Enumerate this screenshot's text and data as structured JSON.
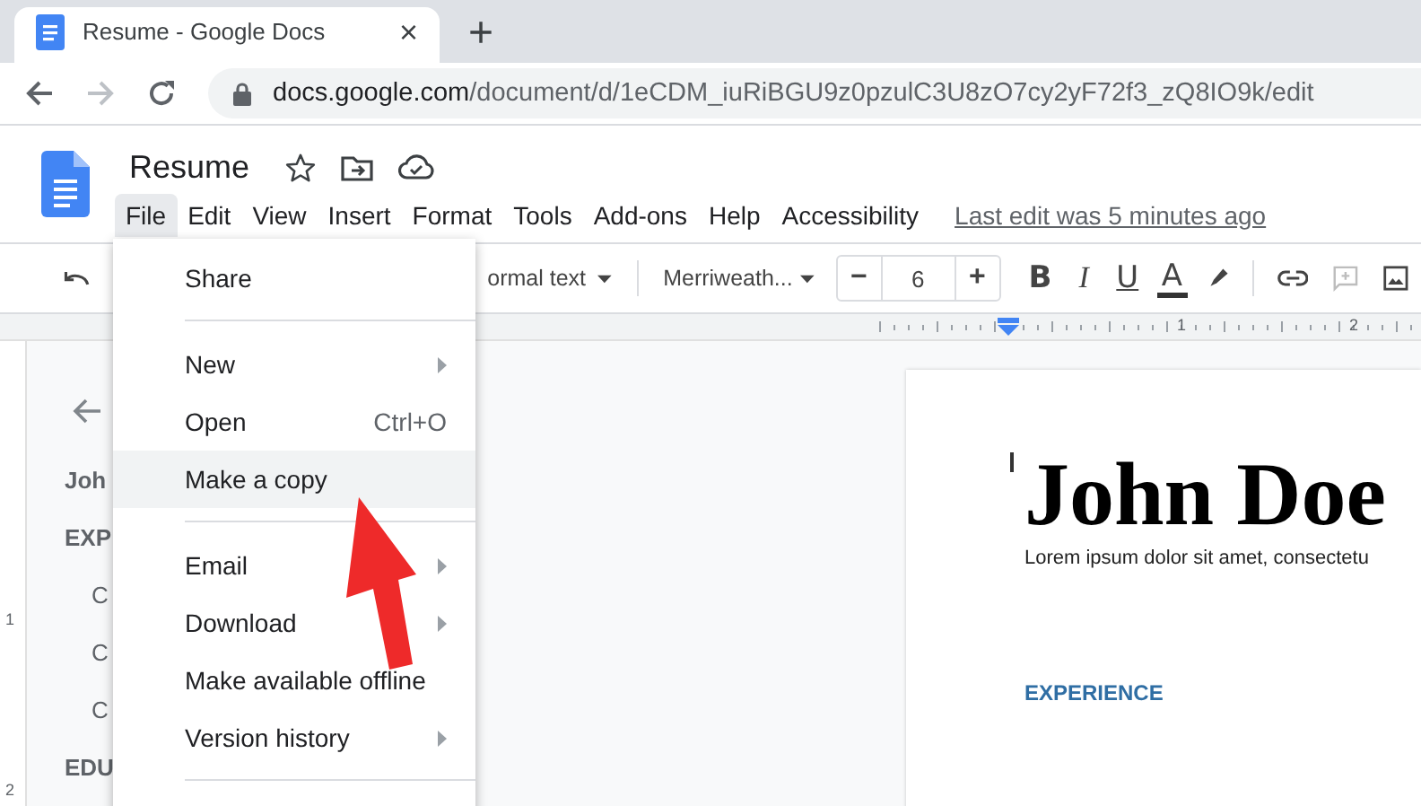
{
  "browser": {
    "tab": {
      "title": "Resume - Google Docs",
      "close": "×"
    },
    "new_tab": "+",
    "url_host": "docs.google.com",
    "url_path": "/document/d/1eCDM_iuRiBGU9z0pzulC3U8zO7cy2yF72f3_zQ8IO9k/edit"
  },
  "doc_title": "Resume",
  "menu_bar": [
    {
      "label": "File",
      "selected": true
    },
    {
      "label": "Edit",
      "selected": false
    },
    {
      "label": "View",
      "selected": false
    },
    {
      "label": "Insert",
      "selected": false
    },
    {
      "label": "Format",
      "selected": false
    },
    {
      "label": "Tools",
      "selected": false
    },
    {
      "label": "Add-ons",
      "selected": false
    },
    {
      "label": "Help",
      "selected": false
    },
    {
      "label": "Accessibility",
      "selected": false
    }
  ],
  "last_edit": "Last edit was 5 minutes ago",
  "toolbar": {
    "style": "ormal text",
    "font": "Merriweath...",
    "size_minus": "−",
    "font_size": "6",
    "size_plus": "+",
    "format_buttons": [
      {
        "label": "B",
        "kind": "bold"
      },
      {
        "label": "I",
        "kind": "italic"
      },
      {
        "label": "U",
        "kind": "underline"
      },
      {
        "label": "A",
        "kind": "color"
      }
    ]
  },
  "ruler": [
    "1",
    "2"
  ],
  "vertical_ruler": [
    "1",
    "2"
  ],
  "outline": [
    {
      "text": "Joh",
      "kind": "title"
    },
    {
      "text": "EXP",
      "kind": "heading"
    },
    {
      "text": "C",
      "kind": "sub"
    },
    {
      "text": "C",
      "kind": "sub"
    },
    {
      "text": "C",
      "kind": "sub"
    },
    {
      "text": "EDU",
      "kind": "heading"
    }
  ],
  "file_menu": [
    {
      "kind": "item",
      "label": "Share",
      "submenu": false,
      "selected": false
    },
    {
      "kind": "divider"
    },
    {
      "kind": "item",
      "label": "New",
      "submenu": true,
      "selected": false
    },
    {
      "kind": "item",
      "label": "Open",
      "shortcut": "Ctrl+O",
      "submenu": false,
      "selected": false
    },
    {
      "kind": "item",
      "label": "Make a copy",
      "submenu": false,
      "selected": true
    },
    {
      "kind": "divider"
    },
    {
      "kind": "item",
      "label": "Email",
      "submenu": true,
      "selected": false
    },
    {
      "kind": "item",
      "label": "Download",
      "submenu": true,
      "selected": false
    },
    {
      "kind": "item",
      "label": "Make available offline",
      "submenu": false,
      "selected": false
    },
    {
      "kind": "item",
      "label": "Version history",
      "submenu": true,
      "selected": false
    },
    {
      "kind": "divider"
    }
  ],
  "page": {
    "name": "John Doe",
    "summary": "Lorem ipsum dolor sit amet, consectetu",
    "section": "EXPERIENCE"
  }
}
